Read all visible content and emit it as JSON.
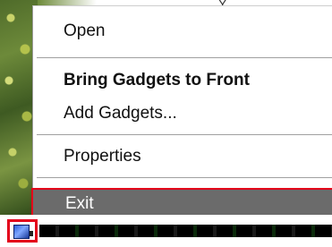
{
  "menu": {
    "items": [
      {
        "label": "Open"
      },
      {
        "label": "Bring Gadgets to Front"
      },
      {
        "label": "Add Gadgets..."
      },
      {
        "label": "Properties"
      },
      {
        "label": "Exit"
      }
    ]
  },
  "top_glyphs": "Y ×",
  "colors": {
    "highlight_bg": "#6b6b6b",
    "annotation_red": "#e3001b",
    "tray_icon_blue": "#2b5fd9"
  },
  "icons": {
    "tray": "sidebar-tray-icon"
  }
}
